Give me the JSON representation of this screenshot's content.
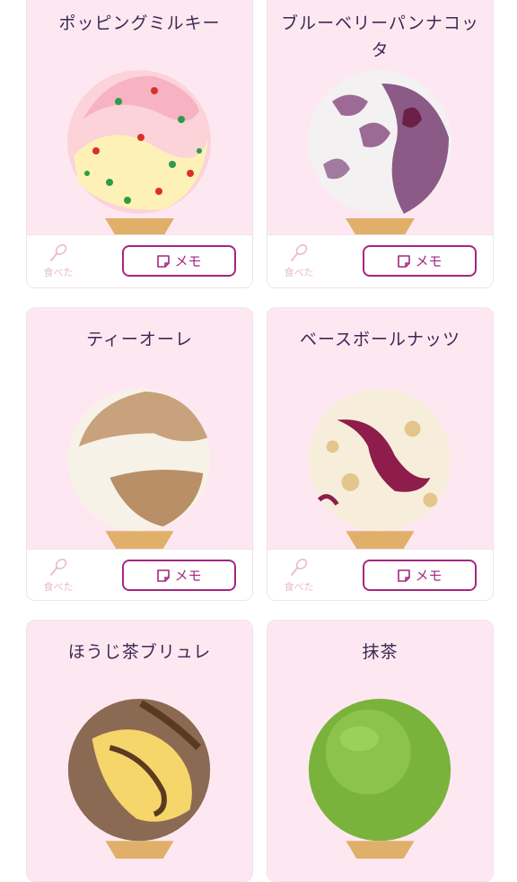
{
  "cards": [
    {
      "name": "ポッピングミルキー",
      "ate_label": "食べた",
      "memo_label": "メモ"
    },
    {
      "name": "ブルーベリーパンナコッタ",
      "ate_label": "食べた",
      "memo_label": "メモ"
    },
    {
      "name": "ティーオーレ",
      "ate_label": "食べた",
      "memo_label": "メモ"
    },
    {
      "name": "ベースボールナッツ",
      "ate_label": "食べた",
      "memo_label": "メモ"
    },
    {
      "name": "ほうじ茶ブリュレ"
    },
    {
      "name": "抹茶"
    }
  ],
  "icons": {
    "ate": "spoon-icon",
    "memo": "memo-icon"
  },
  "colors": {
    "card_bg": "#fde8f1",
    "accent": "#a4277f",
    "title": "#3b2a55",
    "muted": "#e9b9d0"
  }
}
